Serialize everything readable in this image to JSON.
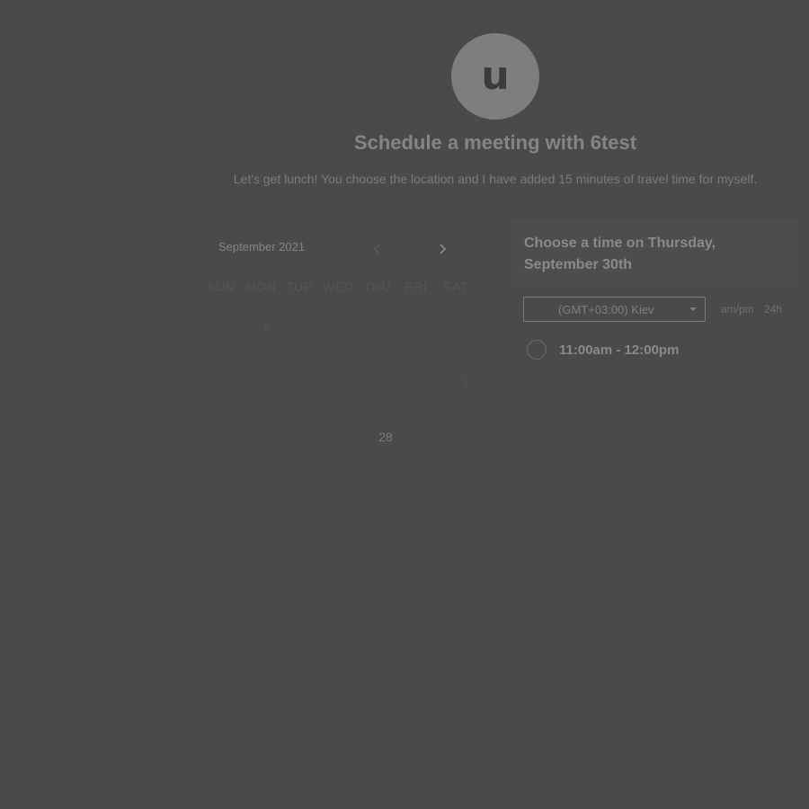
{
  "avatar": {
    "initial": "u"
  },
  "header": {
    "title": "Schedule a meeting with 6test",
    "subtitle": "Let's get lunch! You choose the location and I have added 15 minutes of travel time for myself."
  },
  "calendar": {
    "month_label": "September 2021",
    "prev_icon": "chevron-left-icon",
    "next_icon": "chevron-right-icon",
    "weekdays": [
      "SUN",
      "MON",
      "TUE",
      "WED",
      "THU",
      "FRI",
      "SAT"
    ],
    "visible_days": {
      "six": "6",
      "five": "5",
      "twenty_eight": "28"
    }
  },
  "panel": {
    "title": "Choose a time on Thursday, September 30th",
    "timezone": "(GMT+03:00) Kiev",
    "format_ampm": "am/pm",
    "format_24h": "24h",
    "slots": [
      {
        "label": "11:00am - 12:00pm"
      }
    ]
  },
  "colors": {
    "background": "#4a4a4a",
    "avatar": "#7e7e7e",
    "text": "#858585"
  }
}
